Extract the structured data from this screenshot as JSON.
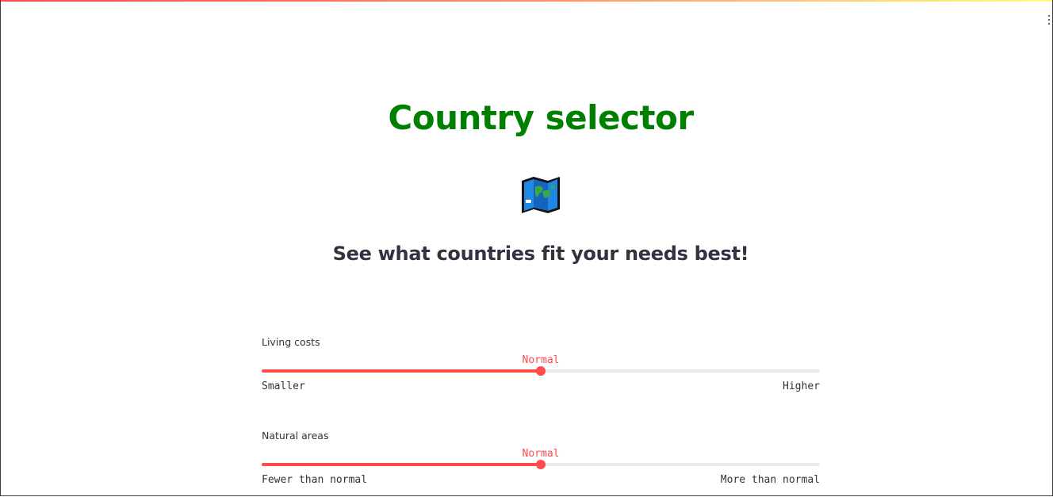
{
  "app": {
    "title": "Country selector",
    "subtitle": "See what countries fit your needs best!",
    "icon": "world-map-icon",
    "title_color": "#008000",
    "accent_color": "#ff4b4b"
  },
  "sliders": [
    {
      "label": "Living costs",
      "value_label": "Normal",
      "min_label": "Smaller",
      "max_label": "Higher",
      "position_fraction": 0.5
    },
    {
      "label": "Natural areas",
      "value_label": "Normal",
      "min_label": "Fewer than normal",
      "max_label": "More than normal",
      "position_fraction": 0.5
    }
  ]
}
